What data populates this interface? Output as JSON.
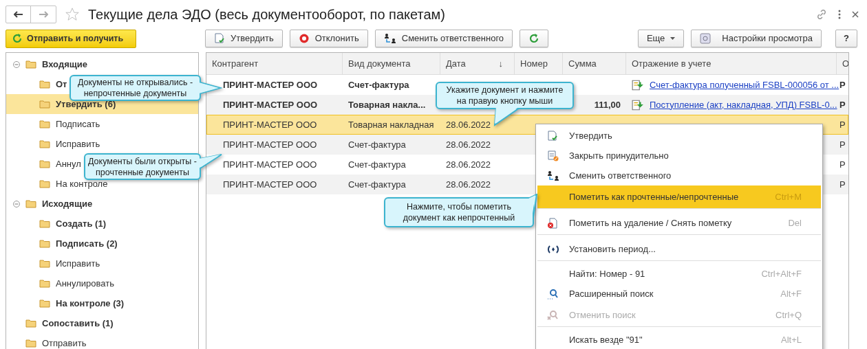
{
  "window": {
    "title": "Текущие дела ЭДО (весь документооборот, по пакетам)"
  },
  "send_button": "Отправить и получить",
  "toolbar": {
    "left": [
      {
        "label": "Утвердить",
        "kind": "approve"
      },
      {
        "label": "Отклонить",
        "kind": "reject"
      },
      {
        "label": "Сменить ответственного",
        "kind": "change"
      },
      {
        "kind": "refresh"
      }
    ],
    "more": "Еще",
    "settings": "Настройки просмотра",
    "help": "?"
  },
  "tree": [
    {
      "label": "Входящие",
      "bold": true,
      "selected": false,
      "expanded": true,
      "children": [
        {
          "label": "От",
          "bold": true,
          "selected": false
        },
        {
          "label": "Утвердить (6)",
          "bold": true,
          "selected": true
        },
        {
          "label": "Подписать",
          "bold": false,
          "selected": false
        },
        {
          "label": "Исправить",
          "bold": false,
          "selected": false
        },
        {
          "label": "Аннул",
          "bold": false,
          "selected": false
        },
        {
          "label": "На контроле",
          "bold": false,
          "selected": false
        }
      ]
    },
    {
      "label": "Исходящие",
      "bold": true,
      "selected": false,
      "expanded": true,
      "children": [
        {
          "label": "Создать (1)",
          "bold": true,
          "selected": false
        },
        {
          "label": "Подписать (2)",
          "bold": true,
          "selected": false
        },
        {
          "label": "Исправить",
          "bold": false,
          "selected": false
        },
        {
          "label": "Аннулировать",
          "bold": false,
          "selected": false
        },
        {
          "label": "На контроле (3)",
          "bold": true,
          "selected": false
        }
      ]
    },
    {
      "label": "Сопоставить (1)",
      "bold": true,
      "selected": false
    },
    {
      "label": "Отправить",
      "bold": false,
      "selected": false
    }
  ],
  "table": {
    "columns": [
      {
        "label": "Контрагент"
      },
      {
        "label": "Вид документа"
      },
      {
        "label": "Дата",
        "sort_mark": "↓"
      },
      {
        "label": "Номер"
      },
      {
        "label": "Сумма"
      },
      {
        "label": "Отражение в учете"
      },
      {
        "label": "О"
      }
    ],
    "rows": [
      {
        "counterparty": "ПРИНТ-МАСТЕР ООО",
        "doc_type": "Счет-фактура",
        "link": "Счет-фактура полученный FSBL-000056 от ...",
        "column_7": "Р",
        "unread": true,
        "selected": false
      },
      {
        "counterparty": "ПРИНТ-МАСТЕР ООО",
        "doc_type": "Товарная накла...",
        "sum": "111,00",
        "link": "Поступление (акт, накладная, УПД) FSBL-0...",
        "column_7": "Р",
        "unread": true,
        "selected": false
      },
      {
        "counterparty": "ПРИНТ-МАСТЕР ООО",
        "doc_type": "Товарная накладная",
        "date": "28.06.2022",
        "column_7": "Р",
        "unread": false,
        "selected": true
      },
      {
        "counterparty": "ПРИНТ-МАСТЕР ООО",
        "doc_type": "Счет-фактура",
        "date": "28.06.2022",
        "column_7": "Р",
        "unread": false,
        "selected": false
      },
      {
        "counterparty": "ПРИНТ-МАСТЕР ООО",
        "doc_type": "Счет-фактура",
        "date": "28.06.2022",
        "column_7": "Р",
        "unread": false,
        "selected": false
      },
      {
        "counterparty": "ПРИНТ-МАСТЕР ООО",
        "doc_type": "Счет-фактура",
        "date": "28.06.2022",
        "column_7": "Р",
        "unread": false,
        "selected": false
      }
    ]
  },
  "context_menu": [
    {
      "label": "Утвердить",
      "kind": "approve",
      "highlighted": false,
      "disabled": false,
      "separator_after": false
    },
    {
      "label": "Закрыть принудительно",
      "kind": "close_doc",
      "highlighted": false,
      "disabled": false,
      "separator_after": false
    },
    {
      "label": "Сменить ответственного",
      "kind": "change",
      "highlighted": false,
      "disabled": false,
      "separator_after": false
    },
    {
      "label": "Пометить как прочтенные/непрочтенные",
      "shortcut": "Ctrl+M",
      "highlighted": true,
      "disabled": false,
      "separator_after": true
    },
    {
      "label": "Пометить на удаление / Снять пометку",
      "shortcut": "Del",
      "kind": "delete",
      "highlighted": false,
      "disabled": false,
      "separator_after": true
    },
    {
      "label": "Установить период...",
      "kind": "period",
      "highlighted": false,
      "disabled": false,
      "separator_after": true
    },
    {
      "label": "Найти: Номер - 91",
      "shortcut": "Ctrl+Alt+F",
      "highlighted": false,
      "disabled": false,
      "separator_after": false
    },
    {
      "label": "Расширенный поиск",
      "shortcut": "Alt+F",
      "kind": "search",
      "highlighted": false,
      "disabled": false,
      "separator_after": false
    },
    {
      "label": "Отменить поиск",
      "shortcut": "Ctrl+Q",
      "kind": "search_cancel",
      "highlighted": false,
      "disabled": true,
      "separator_after": true
    },
    {
      "label": "Искать везде \"91\"",
      "shortcut": "Alt+L",
      "highlighted": false,
      "disabled": false,
      "separator_after": false
    }
  ],
  "callouts": [
    {
      "text": "Документы не открывались -\nнепрочтенные документы"
    },
    {
      "text": "Документы были открыты -\nпрочтенные документы"
    },
    {
      "text": "Укажите документ и нажмите\nна правую кнопку мыши"
    },
    {
      "text": "Нажмите, чтобы пометить\nдокумент как непрочтенный"
    }
  ]
}
